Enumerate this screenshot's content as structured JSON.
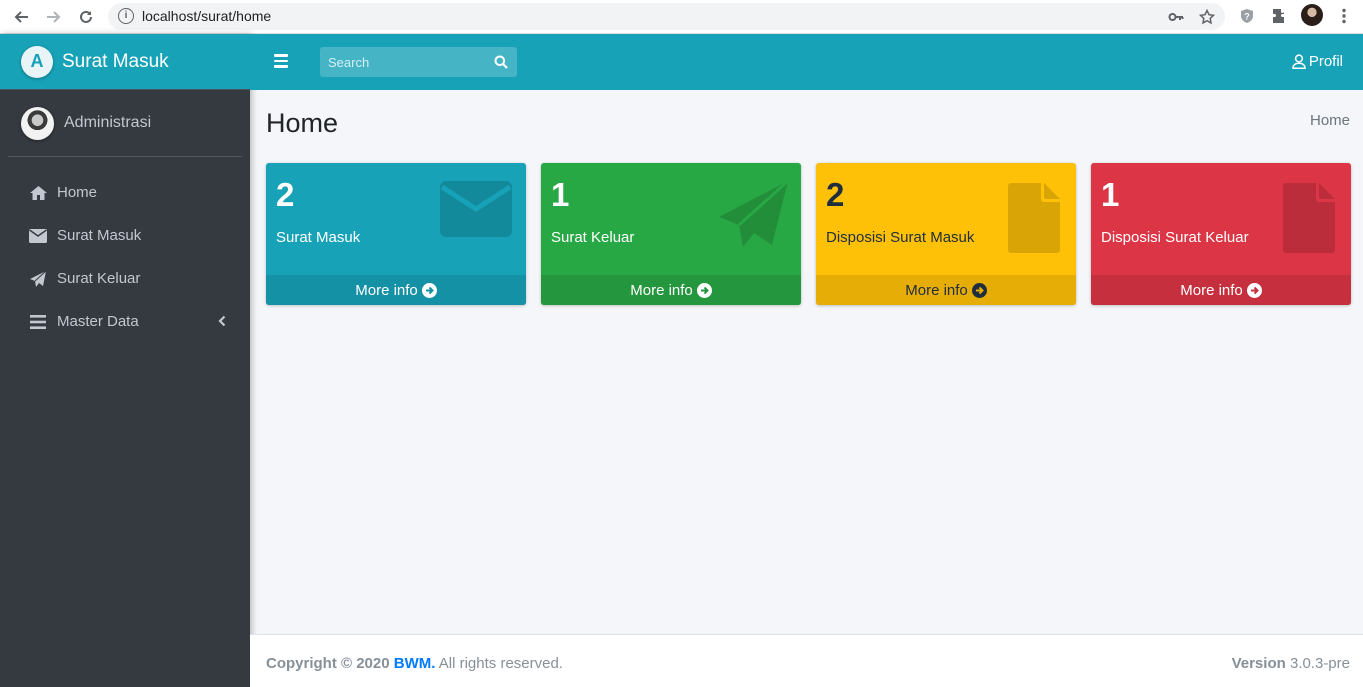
{
  "browser": {
    "url": "localhost/surat/home"
  },
  "brand": {
    "logo_letter": "A",
    "title": "Surat Masuk"
  },
  "user": {
    "name": "Administrasi"
  },
  "sidebar": {
    "items": [
      {
        "label": "Home",
        "icon": "home-icon"
      },
      {
        "label": "Surat Masuk",
        "icon": "envelope-icon"
      },
      {
        "label": "Surat Keluar",
        "icon": "paper-plane-icon"
      },
      {
        "label": "Master Data",
        "icon": "list-icon"
      }
    ]
  },
  "navbar": {
    "search_placeholder": "Search",
    "profile_label": "Profil"
  },
  "page": {
    "title": "Home",
    "breadcrumb": "Home"
  },
  "boxes": [
    {
      "count": "2",
      "label": "Surat Masuk",
      "more": "More info",
      "color": "#17a2b8",
      "icon": "envelope-icon"
    },
    {
      "count": "1",
      "label": "Surat Keluar",
      "more": "More info",
      "color": "#28a745",
      "icon": "paper-plane-icon"
    },
    {
      "count": "2",
      "label": "Disposisi Surat Masuk",
      "more": "More info",
      "color": "#ffc107",
      "icon": "file-icon"
    },
    {
      "count": "1",
      "label": "Disposisi Surat Keluar",
      "more": "More info",
      "color": "#dc3545",
      "icon": "file-icon"
    }
  ],
  "footer": {
    "copyright": "Copyright © 2020",
    "company": "BWM.",
    "rights": "All rights reserved.",
    "version_label": "Version",
    "version": "3.0.3-pre"
  },
  "colors": {
    "primary": "#17a2b8",
    "sidebar_bg": "#343a40",
    "link": "#007bff"
  }
}
